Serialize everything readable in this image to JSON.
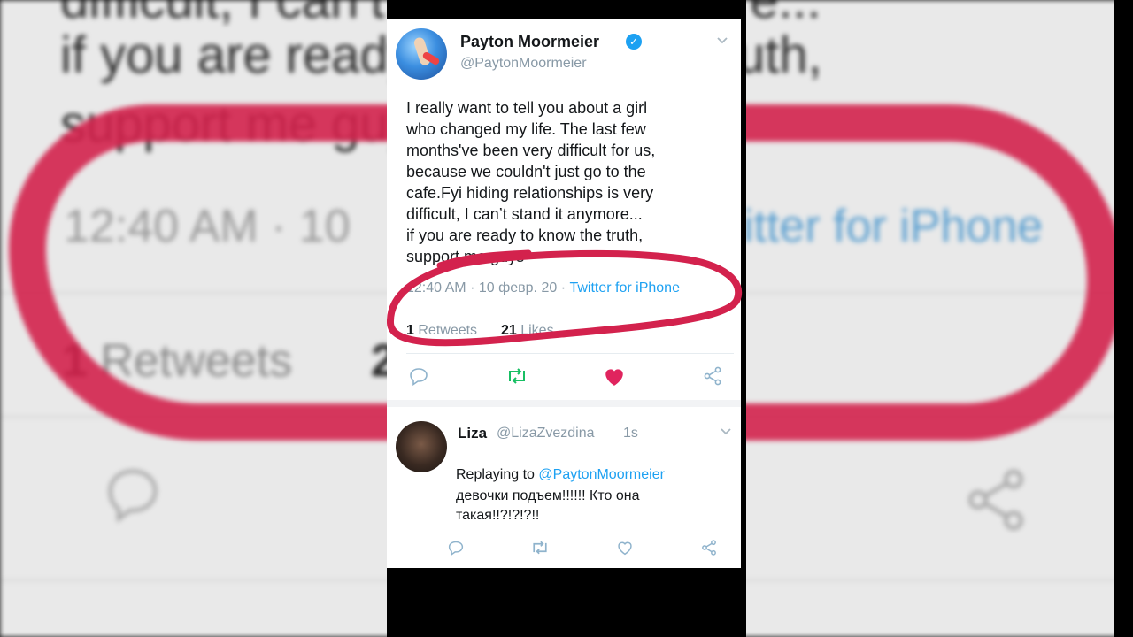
{
  "tweet": {
    "author_name": "Payton Moormeier",
    "author_handle": "@PaytonMoormeier",
    "verified_mark": "✓",
    "menu_chevron": "⌄",
    "text_lines": [
      "I really want to tell you about a girl",
      "who changed my life. The last few",
      "months've been very difficult for us,",
      "because we couldn't just go to the",
      "cafe.Fyi hiding relationships is very",
      "difficult, I can’t stand it anymore...",
      "if you are ready to know the truth,",
      "support me guys"
    ],
    "time": "12:40 AM",
    "dot": "·",
    "date": "10 февр. 20",
    "source": "Twitter for iPhone",
    "retweets_count": "1",
    "retweets_label": "Retweets",
    "likes_count": "21",
    "likes_label": "Likes",
    "actions": [
      "reply-icon",
      "retweet-icon",
      "heart-filled-icon",
      "share-icon"
    ],
    "colors": {
      "accent": "#1da1f2",
      "retweet": "#17bf63",
      "like": "#e0245e",
      "marker": "#d3224d"
    }
  },
  "reply": {
    "author_name": "Liza",
    "author_handle": "@LizaZvezdina",
    "time": "1s",
    "menu_chevron": "⌄",
    "replying_prefix": "Replaying to",
    "replying_mention": "@PaytonMoormeier",
    "text_lines": [
      "девочки подъем!!!!!! Кто она",
      "такая!!?!?!?!!"
    ],
    "actions": [
      "reply-icon",
      "retweet-icon",
      "heart-outline-icon",
      "share-icon"
    ]
  },
  "background": {
    "line1": "difficult, I can’t stand it anymore...",
    "line2": "if you are ready to know the truth,",
    "line3": "support me guys",
    "meta_left": "12:40 AM · 10",
    "meta_right": "itter for iPhone",
    "retweets_count": "1",
    "retweets_label": "Retweets",
    "likes_partial": "2"
  }
}
